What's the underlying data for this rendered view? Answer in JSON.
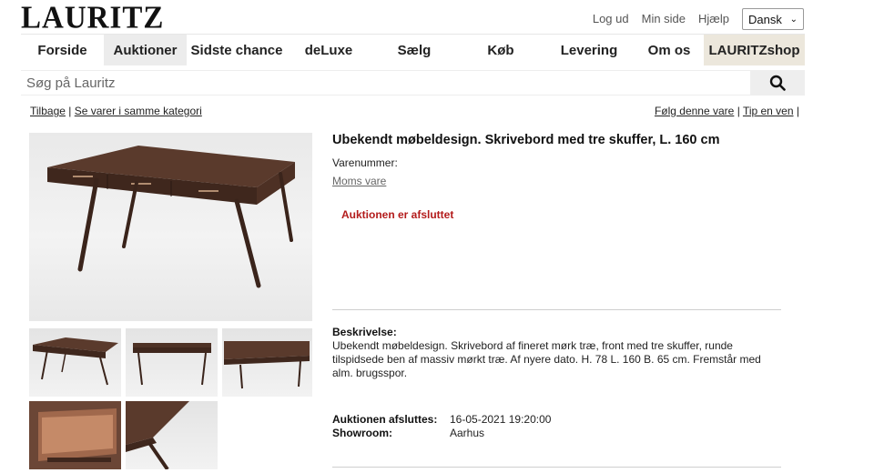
{
  "header": {
    "logo": "LAURITZ",
    "links": [
      "Log ud",
      "Min side",
      "Hjælp"
    ],
    "language": "Dansk"
  },
  "nav": {
    "items": [
      "Forside",
      "Auktioner",
      "Sidste chance",
      "deLuxe",
      "Sælg",
      "Køb",
      "Levering",
      "Om os",
      "LAURITZshop"
    ]
  },
  "search": {
    "placeholder": "Søg på Lauritz"
  },
  "breadcrumbs": {
    "back": "Tilbage",
    "sep": "|",
    "same_category": "Se varer i samme kategori"
  },
  "actions": {
    "follow": "Følg denne vare",
    "sep": "|",
    "tip": "Tip en ven",
    "sep2": "|"
  },
  "item": {
    "title": "Ubekendt møbeldesign. Skrivebord med tre skuffer, L. 160 cm",
    "item_number_label": "Varenummer:",
    "vat_link": "Moms vare",
    "status": "Auktionen er afsluttet",
    "description_label": "Beskrivelse:",
    "description": "Ubekendt møbeldesign. Skrivebord af fineret mørk træ, front med tre skuffer, runde tilspidsede ben af massiv mørkt træ. Af nyere dato. H. 78 L. 160 B. 65 cm. Fremstår med alm. brugsspor.",
    "end_label": "Auktionen afsluttes:",
    "end_value": "16-05-2021 19:20:00",
    "showroom_label": "Showroom:",
    "showroom_value": "Aarhus"
  },
  "colors": {
    "status_red": "#b31b1b",
    "shop_bg": "#ece7dc",
    "desk_wood": "#4e3226"
  },
  "icons": {
    "search": "search-icon",
    "dropdown": "chevron-down-icon"
  }
}
